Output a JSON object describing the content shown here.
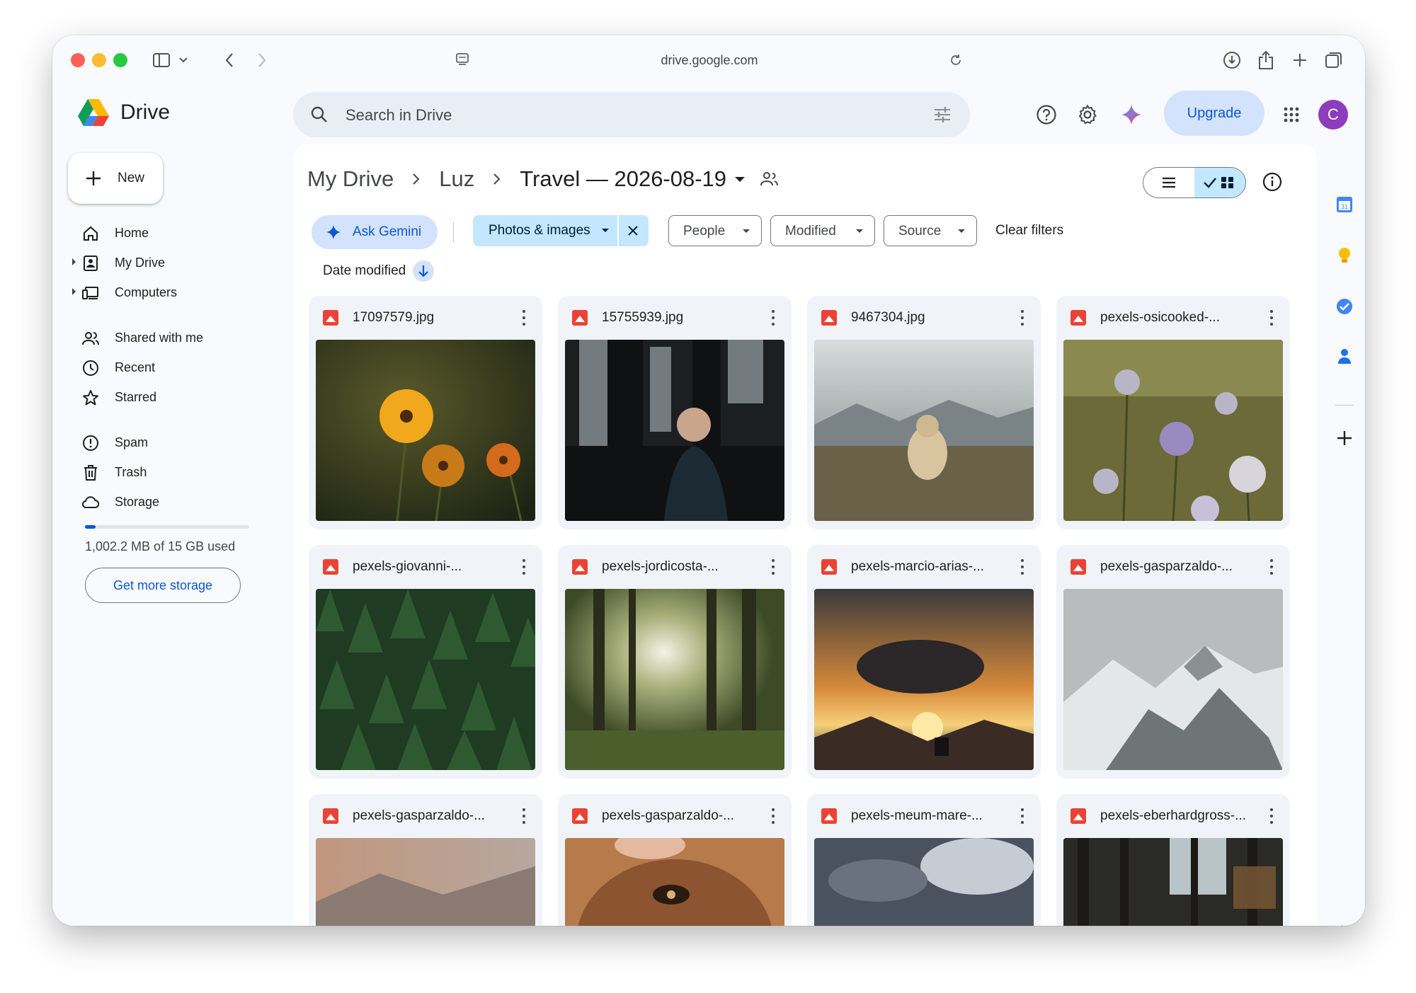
{
  "browser": {
    "url": "drive.google.com"
  },
  "app": {
    "brand": "Drive"
  },
  "search": {
    "placeholder": "Search in Drive"
  },
  "header": {
    "upgrade_label": "Upgrade",
    "avatar_initial": "C"
  },
  "sidebar": {
    "new_label": "New",
    "items": [
      {
        "label": "Home",
        "icon": "home-icon"
      },
      {
        "label": "My Drive",
        "icon": "my-drive-icon",
        "expandable": true
      },
      {
        "label": "Computers",
        "icon": "computers-icon",
        "expandable": true
      },
      {
        "label": "Shared with me",
        "icon": "shared-icon"
      },
      {
        "label": "Recent",
        "icon": "clock-icon"
      },
      {
        "label": "Starred",
        "icon": "star-icon"
      },
      {
        "label": "Spam",
        "icon": "spam-icon"
      },
      {
        "label": "Trash",
        "icon": "trash-icon"
      },
      {
        "label": "Storage",
        "icon": "cloud-icon"
      }
    ],
    "storage_used_fraction": 0.065,
    "storage_text": "1,002.2 MB of 15 GB used",
    "get_more_storage": "Get more storage"
  },
  "breadcrumb": {
    "items": [
      "My Drive",
      "Luz",
      "Travel — 2026-08-19"
    ]
  },
  "view": {
    "mode": "grid"
  },
  "filters": {
    "ask_gemini": "Ask Gemini",
    "active_type": "Photos & images",
    "people": "People",
    "modified": "Modified",
    "source": "Source",
    "clear": "Clear filters"
  },
  "sort": {
    "label": "Date modified",
    "direction": "descending"
  },
  "files": [
    {
      "name": "17097579.jpg",
      "thumb": "flowers"
    },
    {
      "name": "15755939.jpg",
      "thumb": "man-forest"
    },
    {
      "name": "9467304.jpg",
      "thumb": "dog-field"
    },
    {
      "name": "pexels-osicooked-...",
      "thumb": "thistles"
    },
    {
      "name": "pexels-giovanni-...",
      "thumb": "pine-forest"
    },
    {
      "name": "pexels-jordicosta-...",
      "thumb": "sunlit-forest"
    },
    {
      "name": "pexels-marcio-arias-...",
      "thumb": "sunset-rider"
    },
    {
      "name": "pexels-gasparzaldo-...",
      "thumb": "snowy-mountain"
    },
    {
      "name": "pexels-gasparzaldo-...",
      "thumb": "pink-mountain"
    },
    {
      "name": "pexels-gasparzaldo-...",
      "thumb": "dog-face"
    },
    {
      "name": "pexels-meum-mare-...",
      "thumb": "clouds"
    },
    {
      "name": "pexels-eberhardgross-...",
      "thumb": "dark-forest"
    }
  ],
  "colors": {
    "accent": "#0b57d0",
    "chip_active": "#c2e7ff",
    "gemini_chip": "#d3e3fd",
    "avatar": "#8e3bbd",
    "image_file": "#ea4335"
  }
}
